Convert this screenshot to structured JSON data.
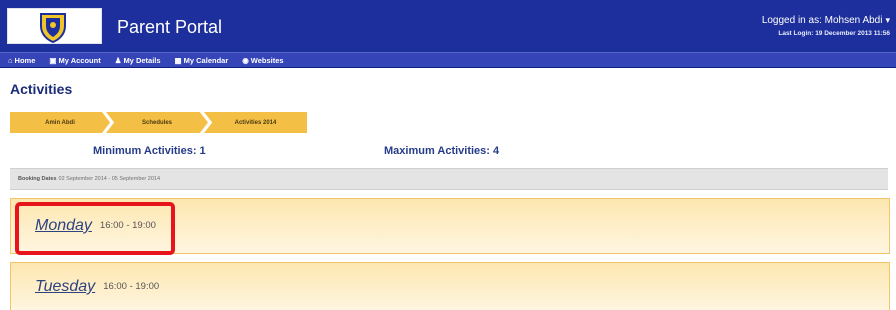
{
  "app": {
    "title": "Parent Portal"
  },
  "user": {
    "logged_in_text": "Logged in as: Mohsen Abdi",
    "last_login_text": "Last Login: 19 December 2013 11:56"
  },
  "nav": {
    "items": [
      {
        "label": "Home",
        "icon": "home-icon",
        "glyph": "⌂"
      },
      {
        "label": "My Account",
        "icon": "account-icon",
        "glyph": "▣"
      },
      {
        "label": "My Details",
        "icon": "user-icon",
        "glyph": "♟"
      },
      {
        "label": "My Calendar",
        "icon": "calendar-icon",
        "glyph": "▦"
      },
      {
        "label": "Websites",
        "icon": "globe-icon",
        "glyph": "◉"
      }
    ]
  },
  "page": {
    "title": "Activities"
  },
  "breadcrumb": {
    "items": [
      "Amin Abdi",
      "Schedules",
      "Activities 2014"
    ]
  },
  "limits": {
    "minimum_text": "Minimum Activities: 1",
    "maximum_text": "Maximum Activities: 4"
  },
  "booking": {
    "label": "Booking Dates",
    "value": "02 September 2014 - 05 September 2014"
  },
  "days": [
    {
      "name": "Monday",
      "time": "16:00 - 19:00"
    },
    {
      "name": "Tuesday",
      "time": "16:00 - 19:00"
    }
  ],
  "colors": {
    "header": "#1d2f9c",
    "nav": "#3545b8",
    "crumb": "#f4bf45",
    "highlight": "#e8141c",
    "title_text": "#1c2c78"
  }
}
